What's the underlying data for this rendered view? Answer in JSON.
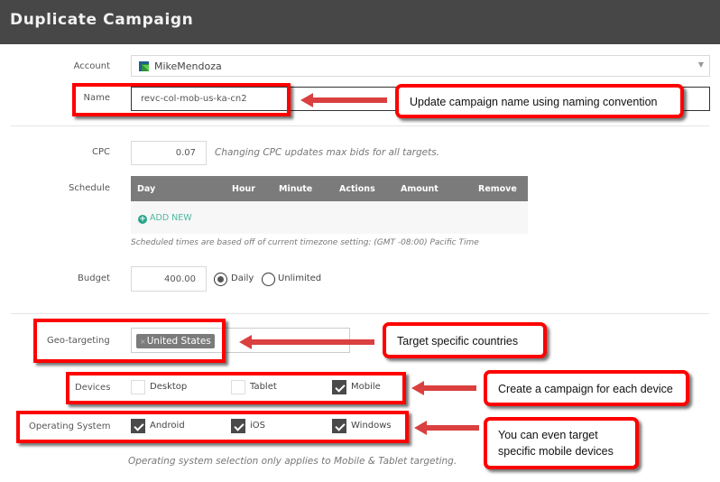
{
  "header": {
    "title": "Duplicate Campaign"
  },
  "account": {
    "label": "Account",
    "value": "MikeMendoza",
    "icon": "account-logo-icon"
  },
  "name": {
    "label": "Name",
    "value": "revc-col-mob-us-ka-cn2"
  },
  "cpc": {
    "label": "CPC",
    "value": "0.07",
    "hint": "Changing CPC updates max bids for all targets."
  },
  "schedule": {
    "label": "Schedule",
    "columns": [
      "Day",
      "Hour",
      "Minute",
      "Actions",
      "Amount",
      "Remove"
    ],
    "add_new_label": "ADD NEW",
    "note": "Scheduled times are based off of current timezone setting: (GMT -08:00) Pacific Time"
  },
  "budget": {
    "label": "Budget",
    "value": "400.00",
    "options": [
      {
        "label": "Daily",
        "selected": true
      },
      {
        "label": "Unlimited",
        "selected": false
      }
    ]
  },
  "geo": {
    "label": "Geo-targeting",
    "tags": [
      "United States"
    ],
    "remove_glyph": "×"
  },
  "devices": {
    "label": "Devices",
    "options": [
      {
        "label": "Desktop",
        "checked": false
      },
      {
        "label": "Tablet",
        "checked": false
      },
      {
        "label": "Mobile",
        "checked": true
      }
    ]
  },
  "os": {
    "label": "Operating System",
    "options": [
      {
        "label": "Android",
        "checked": true
      },
      {
        "label": "iOS",
        "checked": true
      },
      {
        "label": "Windows",
        "checked": true
      }
    ],
    "note": "Operating system selection only applies to Mobile & Tablet targeting."
  },
  "callouts": {
    "name": "Update campaign name using naming convention",
    "geo": "Target specific countries",
    "devices": "Create a campaign for each device",
    "os_line1": "You can even target",
    "os_line2": "specific mobile devices"
  },
  "colors": {
    "highlight": "#ff0000",
    "arrow": "#d9403f",
    "header_bg": "#474747",
    "accent_green": "#2aa588"
  }
}
